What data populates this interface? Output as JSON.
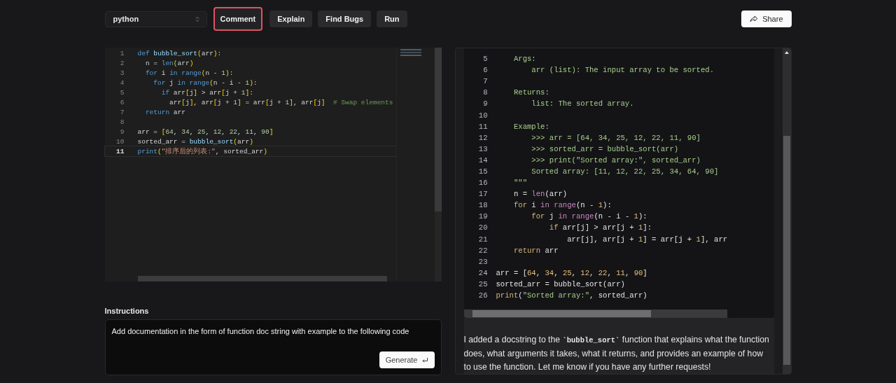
{
  "toolbar": {
    "language_select": {
      "value": "python"
    },
    "actions": [
      {
        "label": "Comment",
        "selected": true
      },
      {
        "label": "Explain",
        "selected": false
      },
      {
        "label": "Find Bugs",
        "selected": false
      },
      {
        "label": "Run",
        "selected": false
      }
    ],
    "share_button": {
      "label": "Share"
    }
  },
  "editor": {
    "lines": [
      {
        "number": "1",
        "current": false,
        "tokens": [
          {
            "kind": "kw",
            "text": "def "
          },
          {
            "kind": "fn",
            "text": "bubble_sort"
          },
          {
            "kind": "br",
            "text": "("
          },
          {
            "kind": "pl",
            "text": "arr"
          },
          {
            "kind": "br",
            "text": ")"
          },
          {
            "kind": "pl",
            "text": ":"
          }
        ]
      },
      {
        "number": "2",
        "current": false,
        "tokens": [
          {
            "kind": "pl",
            "text": "  n = "
          },
          {
            "kind": "kw",
            "text": "len"
          },
          {
            "kind": "br",
            "text": "("
          },
          {
            "kind": "pl",
            "text": "arr"
          },
          {
            "kind": "br",
            "text": ")"
          }
        ]
      },
      {
        "number": "3",
        "current": false,
        "tokens": [
          {
            "kind": "kw",
            "text": "  for "
          },
          {
            "kind": "pl",
            "text": "i "
          },
          {
            "kind": "kw",
            "text": "in range"
          },
          {
            "kind": "br",
            "text": "("
          },
          {
            "kind": "pl",
            "text": "n - "
          },
          {
            "kind": "num",
            "text": "1"
          },
          {
            "kind": "br",
            "text": ")"
          },
          {
            "kind": "pl",
            "text": ":"
          }
        ]
      },
      {
        "number": "4",
        "current": false,
        "tokens": [
          {
            "kind": "kw",
            "text": "    for "
          },
          {
            "kind": "pl",
            "text": "j "
          },
          {
            "kind": "kw",
            "text": "in range"
          },
          {
            "kind": "br",
            "text": "("
          },
          {
            "kind": "pl",
            "text": "n - i - "
          },
          {
            "kind": "num",
            "text": "1"
          },
          {
            "kind": "br",
            "text": ")"
          },
          {
            "kind": "pl",
            "text": ":"
          }
        ]
      },
      {
        "number": "5",
        "current": false,
        "tokens": [
          {
            "kind": "kw",
            "text": "      if "
          },
          {
            "kind": "pl",
            "text": "arr"
          },
          {
            "kind": "br",
            "text": "["
          },
          {
            "kind": "pl",
            "text": "j"
          },
          {
            "kind": "br",
            "text": "]"
          },
          {
            "kind": "pl",
            "text": " > arr"
          },
          {
            "kind": "br",
            "text": "["
          },
          {
            "kind": "pl",
            "text": "j + "
          },
          {
            "kind": "num",
            "text": "1"
          },
          {
            "kind": "br",
            "text": "]"
          },
          {
            "kind": "pl",
            "text": ":"
          }
        ]
      },
      {
        "number": "6",
        "current": false,
        "tokens": [
          {
            "kind": "pl",
            "text": "        arr"
          },
          {
            "kind": "br",
            "text": "["
          },
          {
            "kind": "pl",
            "text": "j"
          },
          {
            "kind": "br",
            "text": "]"
          },
          {
            "kind": "pl",
            "text": ", arr"
          },
          {
            "kind": "br",
            "text": "["
          },
          {
            "kind": "pl",
            "text": "j + "
          },
          {
            "kind": "num",
            "text": "1"
          },
          {
            "kind": "br",
            "text": "]"
          },
          {
            "kind": "pl",
            "text": " = arr"
          },
          {
            "kind": "br",
            "text": "["
          },
          {
            "kind": "pl",
            "text": "j + "
          },
          {
            "kind": "num",
            "text": "1"
          },
          {
            "kind": "br",
            "text": "]"
          },
          {
            "kind": "pl",
            "text": ", arr"
          },
          {
            "kind": "br",
            "text": "["
          },
          {
            "kind": "pl",
            "text": "j"
          },
          {
            "kind": "br",
            "text": "]"
          },
          {
            "kind": "cmt",
            "text": "  # Swap elements"
          }
        ]
      },
      {
        "number": "7",
        "current": false,
        "tokens": [
          {
            "kind": "kw",
            "text": "  return "
          },
          {
            "kind": "pl",
            "text": "arr"
          }
        ]
      },
      {
        "number": "8",
        "current": false
      },
      {
        "number": "9",
        "current": false,
        "tokens": [
          {
            "kind": "pl",
            "text": "arr = "
          },
          {
            "kind": "br",
            "text": "["
          },
          {
            "kind": "num",
            "text": "64"
          },
          {
            "kind": "pl",
            "text": ", "
          },
          {
            "kind": "num",
            "text": "34"
          },
          {
            "kind": "pl",
            "text": ", "
          },
          {
            "kind": "num",
            "text": "25"
          },
          {
            "kind": "pl",
            "text": ", "
          },
          {
            "kind": "num",
            "text": "12"
          },
          {
            "kind": "pl",
            "text": ", "
          },
          {
            "kind": "num",
            "text": "22"
          },
          {
            "kind": "pl",
            "text": ", "
          },
          {
            "kind": "num",
            "text": "11"
          },
          {
            "kind": "pl",
            "text": ", "
          },
          {
            "kind": "num",
            "text": "90"
          },
          {
            "kind": "br",
            "text": "]"
          }
        ]
      },
      {
        "number": "10",
        "current": false,
        "tokens": [
          {
            "kind": "pl",
            "text": "sorted_arr = "
          },
          {
            "kind": "fn",
            "text": "bubble_sort"
          },
          {
            "kind": "br",
            "text": "("
          },
          {
            "kind": "pl",
            "text": "arr"
          },
          {
            "kind": "br",
            "text": ")"
          }
        ]
      },
      {
        "number": "11",
        "current": true,
        "tokens": [
          {
            "kind": "kw",
            "text": "print"
          },
          {
            "kind": "br",
            "text": "("
          },
          {
            "kind": "str",
            "text": "\"排序后的列表:\""
          },
          {
            "kind": "pl",
            "text": ", sorted_arr"
          },
          {
            "kind": "br",
            "text": ")"
          }
        ]
      }
    ]
  },
  "instructions": {
    "label": "Instructions",
    "value": "Add documentation in the form of function doc string with example to the following code",
    "generate_button": {
      "label": "Generate"
    }
  },
  "result": {
    "code_lines": [
      {
        "number": "5",
        "tokens": [
          {
            "kind": "doc",
            "text": "    Args:"
          }
        ]
      },
      {
        "number": "6",
        "tokens": [
          {
            "kind": "doc",
            "text": "        arr (list): The input array to be sorted."
          }
        ]
      },
      {
        "number": "7"
      },
      {
        "number": "8",
        "tokens": [
          {
            "kind": "doc",
            "text": "    Returns:"
          }
        ]
      },
      {
        "number": "9",
        "tokens": [
          {
            "kind": "doc",
            "text": "        list: The sorted array."
          }
        ]
      },
      {
        "number": "10"
      },
      {
        "number": "11",
        "tokens": [
          {
            "kind": "doc",
            "text": "    Example:"
          }
        ]
      },
      {
        "number": "12",
        "tokens": [
          {
            "kind": "doc",
            "text": "        >>> arr = [64, 34, 25, 12, 22, 11, 90]"
          }
        ]
      },
      {
        "number": "13",
        "tokens": [
          {
            "kind": "doc",
            "text": "        >>> sorted_arr = bubble_sort(arr)"
          }
        ]
      },
      {
        "number": "14",
        "tokens": [
          {
            "kind": "doc",
            "text": "        >>> print(\"Sorted array:\", sorted_arr)"
          }
        ]
      },
      {
        "number": "15",
        "tokens": [
          {
            "kind": "doc",
            "text": "        Sorted array: [11, 12, 22, 25, 34, 64, 90]"
          }
        ]
      },
      {
        "number": "16",
        "tokens": [
          {
            "kind": "doc",
            "text": "    \"\"\""
          }
        ]
      },
      {
        "number": "17",
        "tokens": [
          {
            "kind": "pl",
            "text": "    n = "
          },
          {
            "kind": "bi",
            "text": "len"
          },
          {
            "kind": "pl",
            "text": "(arr)"
          }
        ]
      },
      {
        "number": "18",
        "tokens": [
          {
            "kind": "kw",
            "text": "    for "
          },
          {
            "kind": "pl",
            "text": "i "
          },
          {
            "kind": "bi",
            "text": "in range"
          },
          {
            "kind": "pl",
            "text": "(n - "
          },
          {
            "kind": "num",
            "text": "1"
          },
          {
            "kind": "pl",
            "text": "):"
          }
        ]
      },
      {
        "number": "19",
        "tokens": [
          {
            "kind": "kw",
            "text": "        for "
          },
          {
            "kind": "pl",
            "text": "j "
          },
          {
            "kind": "bi",
            "text": "in range"
          },
          {
            "kind": "pl",
            "text": "(n - i - "
          },
          {
            "kind": "num",
            "text": "1"
          },
          {
            "kind": "pl",
            "text": "):"
          }
        ]
      },
      {
        "number": "20",
        "tokens": [
          {
            "kind": "kw",
            "text": "            if "
          },
          {
            "kind": "pl",
            "text": "arr[j] > arr[j + "
          },
          {
            "kind": "num",
            "text": "1"
          },
          {
            "kind": "pl",
            "text": "]:"
          }
        ]
      },
      {
        "number": "21",
        "tokens": [
          {
            "kind": "pl",
            "text": "                arr[j], arr[j + "
          },
          {
            "kind": "num",
            "text": "1"
          },
          {
            "kind": "pl",
            "text": "] = arr[j + "
          },
          {
            "kind": "num",
            "text": "1"
          },
          {
            "kind": "pl",
            "text": "], arr"
          }
        ]
      },
      {
        "number": "22",
        "tokens": [
          {
            "kind": "kw",
            "text": "    return "
          },
          {
            "kind": "pl",
            "text": "arr"
          }
        ]
      },
      {
        "number": "23"
      },
      {
        "number": "24",
        "tokens": [
          {
            "kind": "pl",
            "text": "arr = ["
          },
          {
            "kind": "num",
            "text": "64"
          },
          {
            "kind": "pl",
            "text": ", "
          },
          {
            "kind": "num",
            "text": "34"
          },
          {
            "kind": "pl",
            "text": ", "
          },
          {
            "kind": "num",
            "text": "25"
          },
          {
            "kind": "pl",
            "text": ", "
          },
          {
            "kind": "num",
            "text": "12"
          },
          {
            "kind": "pl",
            "text": ", "
          },
          {
            "kind": "num",
            "text": "22"
          },
          {
            "kind": "pl",
            "text": ", "
          },
          {
            "kind": "num",
            "text": "11"
          },
          {
            "kind": "pl",
            "text": ", "
          },
          {
            "kind": "num",
            "text": "90"
          },
          {
            "kind": "pl",
            "text": "]"
          }
        ]
      },
      {
        "number": "25",
        "tokens": [
          {
            "kind": "pl",
            "text": "sorted_arr = bubble_sort(arr)"
          }
        ]
      },
      {
        "number": "26",
        "tokens": [
          {
            "kind": "kw",
            "text": "print"
          },
          {
            "kind": "pl",
            "text": "("
          },
          {
            "kind": "doc",
            "text": "\"Sorted array:\""
          },
          {
            "kind": "pl",
            "text": ", sorted_arr)"
          }
        ]
      }
    ],
    "message": "I added a docstring to the **`bubble_sort`** function that explains what the function does, what arguments it takes, what it returns, and provides an example of how to use the function. Let me know if you have any further requests!"
  }
}
